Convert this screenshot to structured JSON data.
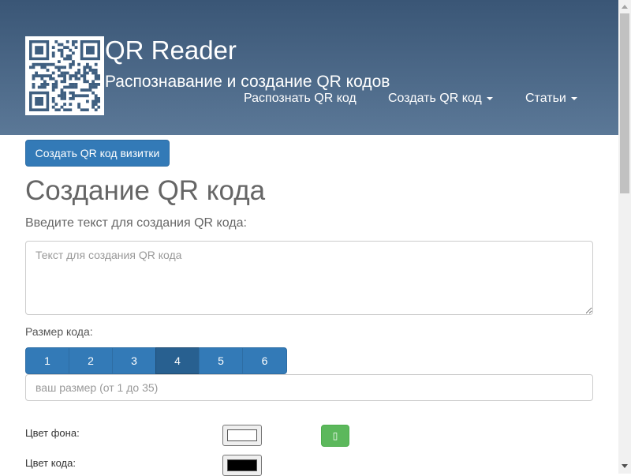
{
  "header": {
    "title": "QR Reader",
    "subtitle": "Распознавание и создание QR кодов",
    "nav": {
      "recognize": "Распознать QR код",
      "create": "Создать QR код",
      "articles": "Статьи"
    }
  },
  "main": {
    "vcard_button": "Создать QR код визитки",
    "page_title": "Создание QR кода",
    "text_label": "Введите текст для создания QR кода:",
    "text_placeholder": "Текст для создания QR кода",
    "size_label": "Размер кода:",
    "size_options": [
      "1",
      "2",
      "3",
      "4",
      "5",
      "6"
    ],
    "size_selected": "4",
    "size_placeholder": "ваш размер (от 1 до 35)",
    "bg_color_label": "Цвет фона:",
    "code_color_label": "Цвет кода:",
    "bg_color_value": "#ffffff",
    "code_color_value": "#000000",
    "green_button_glyph": "▯"
  },
  "colors": {
    "header_top": "#3a5676",
    "header_bottom": "#5b7897",
    "primary": "#337ab7",
    "primary_active": "#286090",
    "success": "#5cb85c",
    "logo_modules": "#3f5f80"
  },
  "icons": {
    "logo": "qr-code-icon",
    "dropdown": "caret-down-icon"
  }
}
